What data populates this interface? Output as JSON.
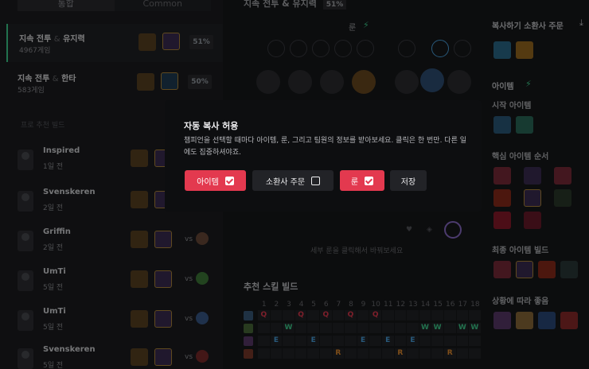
{
  "colors": {
    "accent": "#e3394f",
    "win": "#3ecf8e",
    "bg": "#17181b",
    "modal_bg": "#0d0e10"
  },
  "left": {
    "tabs": [
      "통합",
      "Common"
    ],
    "builds": [
      {
        "primary": "지속 전투",
        "amp": "&",
        "secondary": "유지력",
        "games": "4967게임",
        "winrate": "51%"
      },
      {
        "primary": "지속 전투",
        "amp": "&",
        "secondary": "한타",
        "games": "583게임",
        "winrate": "50%"
      }
    ],
    "pro_label": "프로 추천 빌드",
    "players": [
      {
        "name": "Inspired",
        "time": "1일 전",
        "vs": ""
      },
      {
        "name": "Svenskeren",
        "time": "2일 전",
        "vs": ""
      },
      {
        "name": "Griffin",
        "time": "2일 전",
        "vs": "vs"
      },
      {
        "name": "UmTi",
        "time": "5일 전",
        "vs": "vs"
      },
      {
        "name": "UmTi",
        "time": "5일 전",
        "vs": "vs"
      },
      {
        "name": "Svenskeren",
        "time": "5일 전",
        "vs": "vs"
      }
    ]
  },
  "mid": {
    "header": "지속 전투 & 유지력",
    "header_pct": "51%",
    "rune_label": "룬",
    "rune_hint": "세부 룬을 클릭해서 바꿔보세요",
    "skill_title": "추천 스킬 빌드",
    "skill_levels": [
      "1",
      "2",
      "3",
      "4",
      "5",
      "6",
      "7",
      "8",
      "9",
      "10",
      "11",
      "12",
      "13",
      "14",
      "15",
      "16",
      "17",
      "18"
    ],
    "skill_rows": [
      {
        "key": "q",
        "cells": [
          "Q",
          "",
          "",
          "Q",
          "",
          "Q",
          "",
          "Q",
          "",
          "Q",
          "",
          "",
          "",
          "",
          "",
          "",
          "",
          ""
        ]
      },
      {
        "key": "w",
        "cells": [
          "",
          "",
          "W",
          "",
          "",
          "",
          "",
          "",
          "",
          "",
          "",
          "",
          "",
          "W",
          "W",
          "",
          "W",
          "W"
        ]
      },
      {
        "key": "e",
        "cells": [
          "",
          "E",
          "",
          "",
          "E",
          "",
          "",
          "",
          "E",
          "",
          "E",
          "",
          "E",
          "",
          "",
          "",
          "",
          ""
        ]
      },
      {
        "key": "r",
        "cells": [
          "",
          "",
          "",
          "",
          "",
          "",
          "R",
          "",
          "",
          "",
          "",
          "R",
          "",
          "",
          "",
          "R",
          "",
          ""
        ]
      }
    ]
  },
  "right": {
    "summoner_title": "복사하기 소환사 주문",
    "item_title": "아이템",
    "start_items": "시작 아이템",
    "core_items": "핵심 아이템 순서",
    "final_build": "최종 아이템 빌드",
    "situational": "상황에 따라 좋음"
  },
  "modal": {
    "title": "자동 복사 허용",
    "description": "챔피언을 선택할 때마다 아이템, 룬, 그리고 팀원의 정보를 받아보세요. 클릭은 한 번만. 다른 일에도 집중하셔야죠.",
    "buttons": {
      "items": "아이템",
      "summoner": "소환사 주문",
      "runes": "룬",
      "save": "저장"
    }
  }
}
